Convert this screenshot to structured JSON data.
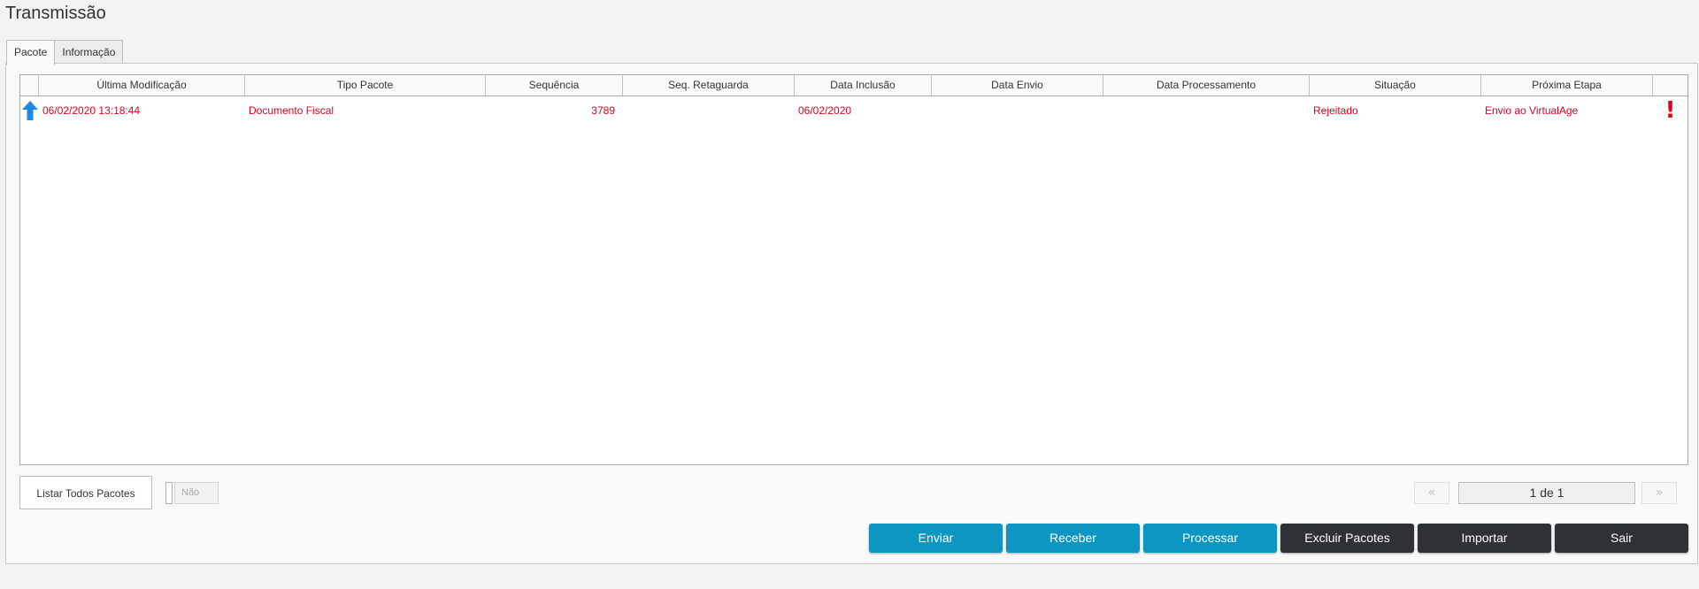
{
  "window": {
    "title": "Transmissão"
  },
  "tabs": [
    {
      "label": "Pacote",
      "active": true
    },
    {
      "label": "Informação",
      "active": false
    }
  ],
  "grid": {
    "columns": [
      "Última Modificação",
      "Tipo Pacote",
      "Sequência",
      "Seq. Retaguarda",
      "Data Inclusão",
      "Data Envio",
      "Data Processamento",
      "Situação",
      "Próxima Etapa"
    ],
    "rows": [
      {
        "direction_icon": "arrow-up-icon",
        "ultima_modificacao": "06/02/2020 13:18:44",
        "tipo_pacote": "Documento Fiscal",
        "sequencia": "3789",
        "seq_retaguarda": "",
        "data_inclusao": "06/02/2020",
        "data_envio": "",
        "data_processamento": "",
        "situacao": "Rejeitado",
        "proxima_etapa": "Envio ao VirtualAge",
        "status_icon": "exclamation-icon",
        "status_symbol": "!"
      }
    ],
    "row_color": "#e0001b",
    "arrow_color": "#1e88e5"
  },
  "controls": {
    "list_all_label": "Listar Todos Pacotes",
    "toggle_value": "Não"
  },
  "pager": {
    "prev_symbol": "«",
    "next_symbol": "»",
    "text": "1 de 1"
  },
  "actions": [
    {
      "label": "Enviar",
      "style": "blue"
    },
    {
      "label": "Receber",
      "style": "blue"
    },
    {
      "label": "Processar",
      "style": "blue"
    },
    {
      "label": "Excluir Pacotes",
      "style": "dark"
    },
    {
      "label": "Importar",
      "style": "dark"
    },
    {
      "label": "Sair",
      "style": "dark"
    }
  ],
  "colors": {
    "blue_button": "#0e96c3",
    "dark_button": "#2e3136"
  }
}
